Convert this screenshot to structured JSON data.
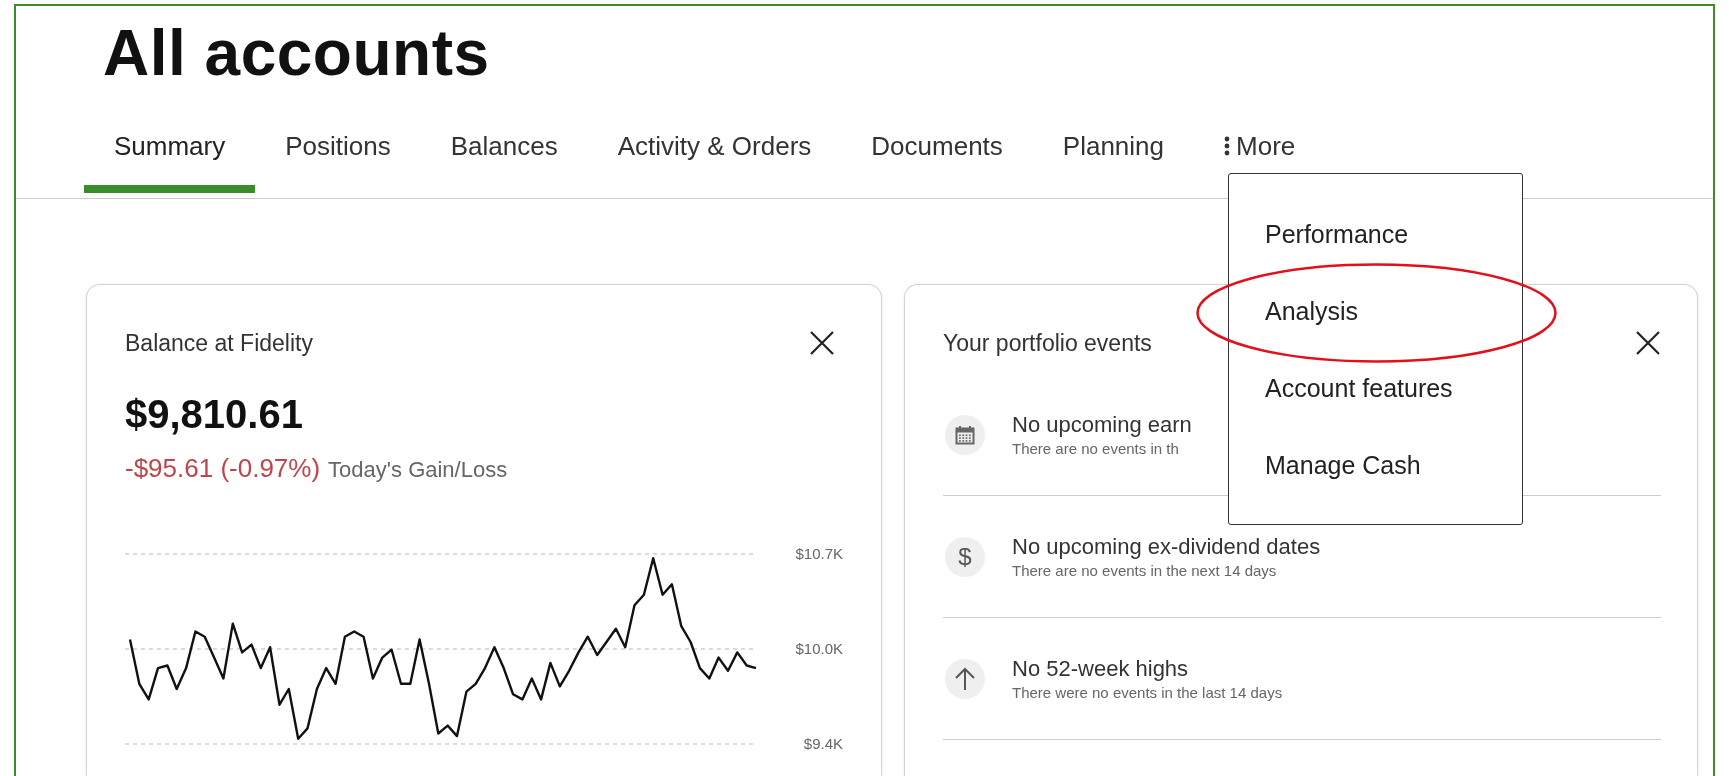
{
  "page": {
    "title": "All accounts"
  },
  "tabs": [
    {
      "label": "Summary",
      "selected": true,
      "kind": "plain"
    },
    {
      "label": "Positions",
      "selected": false,
      "kind": "plain"
    },
    {
      "label": "Balances",
      "selected": false,
      "kind": "plain"
    },
    {
      "label": "Activity & Orders",
      "selected": false,
      "kind": "plain"
    },
    {
      "label": "Documents",
      "selected": false,
      "kind": "plain"
    },
    {
      "label": "Planning",
      "selected": false,
      "kind": "plain"
    },
    {
      "label": "More",
      "selected": false,
      "kind": "menu"
    }
  ],
  "more_menu": {
    "expanded": true,
    "items": [
      {
        "label": "Performance",
        "circled": false
      },
      {
        "label": "Analysis",
        "circled": true
      },
      {
        "label": "Account features",
        "circled": false
      },
      {
        "label": "Manage Cash",
        "circled": false
      }
    ]
  },
  "balance_card": {
    "title": "Balance at Fidelity",
    "amount": "$9,810.61",
    "change": "-$95.61 (-0.97%)",
    "change_label": "Today's Gain/Loss",
    "chart_data": {
      "type": "line",
      "ylim": [
        9400,
        10700
      ],
      "yticks": [
        {
          "value": 10700,
          "label": "$10.7K"
        },
        {
          "value": 10050,
          "label": "$10.0K"
        },
        {
          "value": 9400,
          "label": "$9.4K"
        }
      ],
      "values": [
        10116,
        9812,
        9705,
        9919,
        9937,
        9776,
        9919,
        10170,
        10134,
        9991,
        9848,
        10224,
        10027,
        10080,
        9919,
        10062,
        9669,
        9776,
        9436,
        9507,
        9776,
        9919,
        9812,
        10134,
        10170,
        10134,
        9848,
        9991,
        10045,
        9812,
        9812,
        10116,
        9812,
        9472,
        9526,
        9454,
        9758,
        9812,
        9919,
        10062,
        9919,
        9740,
        9705,
        9848,
        9705,
        9955,
        9794,
        9901,
        10027,
        10134,
        10009,
        10098,
        10188,
        10062,
        10349,
        10421,
        10671,
        10421,
        10493,
        10206,
        10098,
        9919,
        9848,
        9991,
        9901,
        10027,
        9937,
        9919
      ]
    }
  },
  "events_card": {
    "title": "Your portfolio events",
    "events": [
      {
        "kind": "earnings",
        "title": "No upcoming earn",
        "subtitle": "There are no events in th"
      },
      {
        "kind": "dividend",
        "symbol": "$",
        "title": "No upcoming ex-dividend dates",
        "subtitle": "There are no events in the next 14 days"
      },
      {
        "kind": "high",
        "title": "No 52-week highs",
        "subtitle": "There were no events in the last 14 days"
      }
    ]
  }
}
